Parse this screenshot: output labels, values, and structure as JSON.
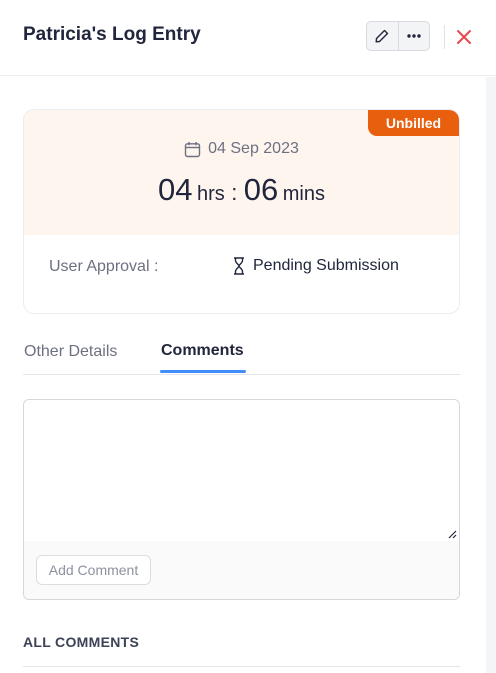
{
  "header": {
    "title": "Patricia's Log Entry",
    "edit_icon": "pencil-icon",
    "more_icon": "more-horizontal-icon",
    "close_icon": "close-icon"
  },
  "entry": {
    "badge": "Unbilled",
    "date": "04 Sep 2023",
    "hours": "04",
    "hours_unit": "hrs",
    "separator": ":",
    "minutes": "06",
    "minutes_unit": "mins",
    "approval_label": "User Approval :",
    "approval_status": "Pending Submission",
    "date_icon": "calendar-icon",
    "status_icon": "hourglass-icon"
  },
  "tabs": [
    {
      "label": "Other Details",
      "active": false
    },
    {
      "label": "Comments",
      "active": true
    }
  ],
  "comment": {
    "value": "",
    "add_button": "Add Comment"
  },
  "all_comments_heading": "ALL COMMENTS",
  "colors": {
    "badge": "#e8600d",
    "card_background": "#fef5ef",
    "tab_accent": "#408dfb",
    "close": "#e5484d"
  }
}
